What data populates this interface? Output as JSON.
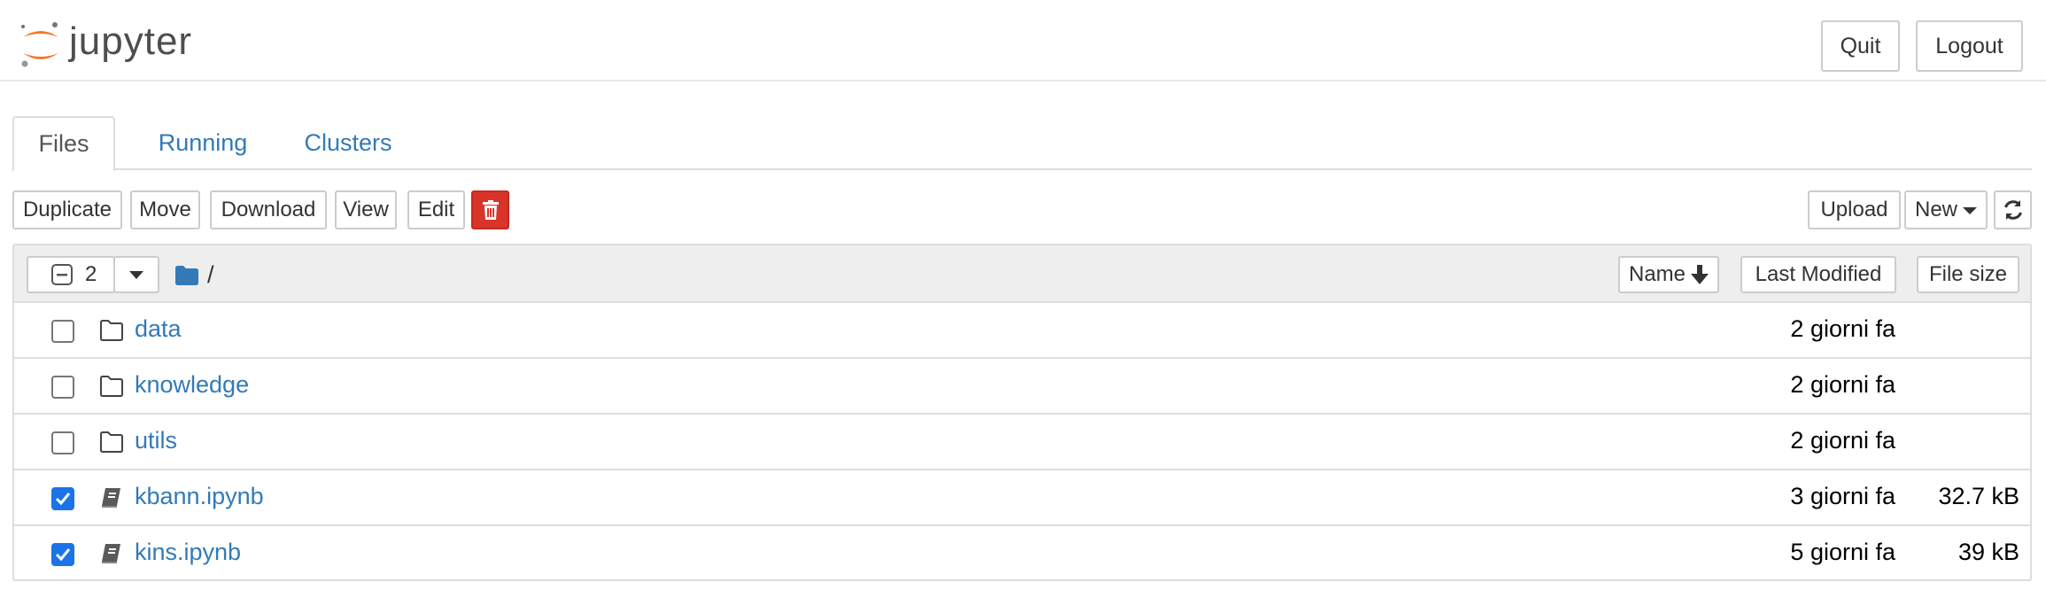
{
  "header": {
    "logo_text": "jupyter",
    "quit_label": "Quit",
    "logout_label": "Logout"
  },
  "tabs": [
    {
      "label": "Files",
      "active": true
    },
    {
      "label": "Running",
      "active": false
    },
    {
      "label": "Clusters",
      "active": false
    }
  ],
  "toolbar": {
    "duplicate_label": "Duplicate",
    "move_label": "Move",
    "download_label": "Download",
    "view_label": "View",
    "edit_label": "Edit",
    "delete_icon": "trash-icon",
    "upload_label": "Upload",
    "new_label": "New",
    "refresh_icon": "refresh-icon"
  },
  "list_header": {
    "selected_count": "2",
    "breadcrumb_path": "/",
    "sort_name_label": "Name",
    "last_modified_label": "Last Modified",
    "file_size_label": "File size"
  },
  "files": [
    {
      "name": "data",
      "type": "folder",
      "modified": "2 giorni fa",
      "size": "",
      "checked": false
    },
    {
      "name": "knowledge",
      "type": "folder",
      "modified": "2 giorni fa",
      "size": "",
      "checked": false
    },
    {
      "name": "utils",
      "type": "folder",
      "modified": "2 giorni fa",
      "size": "",
      "checked": false
    },
    {
      "name": "kbann.ipynb",
      "type": "notebook",
      "modified": "3 giorni fa",
      "size": "32.7 kB",
      "checked": true
    },
    {
      "name": "kins.ipynb",
      "type": "notebook",
      "modified": "5 giorni fa",
      "size": "39 kB",
      "checked": true
    }
  ],
  "colors": {
    "accent": "#337ab7",
    "danger": "#d9342a",
    "checkbox": "#1a73e8",
    "logo_orange": "#f37726"
  }
}
